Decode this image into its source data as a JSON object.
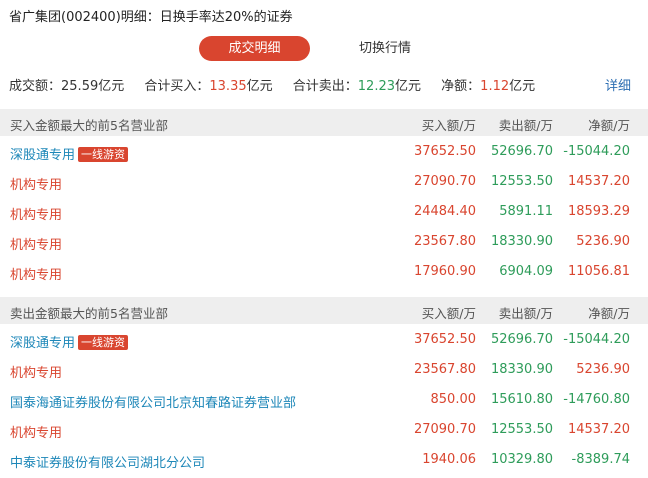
{
  "title": "省广集团(002400)明细：日换手率达20%的证券",
  "tabs": {
    "active": "成交明细",
    "inactive": "切换行情"
  },
  "summary": {
    "turnover_label": "成交额：",
    "turnover_value": "25.59亿元",
    "buy_label": "合计买入：",
    "buy_value": "13.35",
    "buy_unit": "亿元",
    "sell_label": "合计卖出：",
    "sell_value": "12.23",
    "sell_unit": "亿元",
    "net_label": "净额：",
    "net_value": "1.12",
    "net_unit": "亿元",
    "detail_link": "详细"
  },
  "buy_table": {
    "title": "买入金额最大的前5名营业部",
    "col_buy": "买入额/万",
    "col_sell": "卖出额/万",
    "col_net": "净额/万",
    "rows": [
      {
        "name": "深股通专用",
        "badge": "一线游资",
        "buy": "37652.50",
        "sell": "52696.70",
        "net": "-15044.20"
      },
      {
        "name": "机构专用",
        "badge": "",
        "buy": "27090.70",
        "sell": "12553.50",
        "net": "14537.20"
      },
      {
        "name": "机构专用",
        "badge": "",
        "buy": "24484.40",
        "sell": "5891.11",
        "net": "18593.29"
      },
      {
        "name": "机构专用",
        "badge": "",
        "buy": "23567.80",
        "sell": "18330.90",
        "net": "5236.90"
      },
      {
        "name": "机构专用",
        "badge": "",
        "buy": "17960.90",
        "sell": "6904.09",
        "net": "11056.81"
      }
    ]
  },
  "sell_table": {
    "title": "卖出金额最大的前5名营业部",
    "col_buy": "买入额/万",
    "col_sell": "卖出额/万",
    "col_net": "净额/万",
    "rows": [
      {
        "name": "深股通专用",
        "badge": "一线游资",
        "buy": "37652.50",
        "sell": "52696.70",
        "net": "-15044.20"
      },
      {
        "name": "机构专用",
        "badge": "",
        "buy": "23567.80",
        "sell": "18330.90",
        "net": "5236.90"
      },
      {
        "name": "国泰海通证券股份有限公司北京知春路证券营业部",
        "badge": "",
        "buy": "850.00",
        "sell": "15610.80",
        "net": "-14760.80"
      },
      {
        "name": "机构专用",
        "badge": "",
        "buy": "27090.70",
        "sell": "12553.50",
        "net": "14537.20"
      },
      {
        "name": "中泰证券股份有限公司湖北分公司",
        "badge": "",
        "buy": "1940.06",
        "sell": "10329.80",
        "net": "-8389.74"
      }
    ]
  },
  "colors": {
    "accent": "#d9452f",
    "positive": "#d9452f",
    "negative": "#2e9c5a",
    "link": "#2d6fb3",
    "header_bg": "#eeeeee"
  }
}
